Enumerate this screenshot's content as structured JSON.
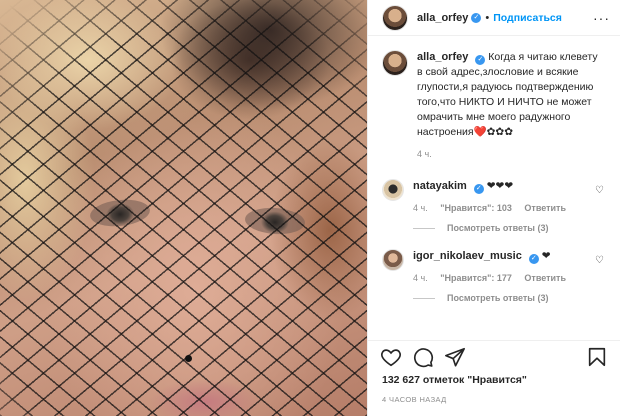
{
  "post": {
    "username": "alla_orfey",
    "follow_label": "Подписаться",
    "separator": "•",
    "more_label": "···"
  },
  "caption": {
    "username": "alla_orfey",
    "text": "Когда я читаю клевету в свой адрес,злословие и всякие глупости,я радуюсь подтверждению того,что НИКТО И НИЧТО не может омрачить мне моего радужного настроения❤️✿✿✿",
    "time": "4 ч."
  },
  "comments": [
    {
      "username": "natayakim",
      "text": "❤❤❤",
      "time": "4 ч.",
      "likes": "\"Нравится\": 103",
      "reply_label": "Ответить",
      "view_replies": "Посмотреть ответы (3)"
    },
    {
      "username": "igor_nikolaev_music",
      "text": "❤",
      "time": "4 ч.",
      "likes": "\"Нравится\": 177",
      "reply_label": "Ответить",
      "view_replies": "Посмотреть ответы (3)"
    }
  ],
  "likes_summary": "132 627 отметок \"Нравится\"",
  "timestamp": "4 ЧАСОВ НАЗАД",
  "icons": {
    "like": "heart-icon",
    "comment": "comment-icon",
    "share": "share-icon",
    "save": "bookmark-icon",
    "verified": "verified-icon"
  }
}
